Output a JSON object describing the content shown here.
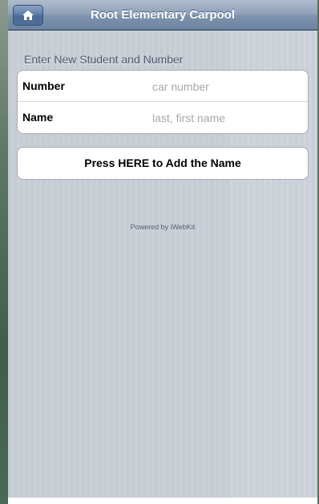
{
  "header": {
    "title": "Root Elementary Carpool",
    "home_icon": "home-icon"
  },
  "form": {
    "heading": "Enter New Student and Number",
    "fields": [
      {
        "label": "Number",
        "placeholder": "car number",
        "value": ""
      },
      {
        "label": "Name",
        "placeholder": "last, first name",
        "value": ""
      }
    ],
    "submit_label": "Press HERE to Add the Name"
  },
  "footer": {
    "text": "Powered by iWebKit"
  },
  "colors": {
    "topbar": "#7d93ae",
    "background": "#c5ccd4",
    "home_button": "#4a6b96",
    "heading_text": "#4c566c",
    "placeholder_text": "#a8a8a8"
  }
}
